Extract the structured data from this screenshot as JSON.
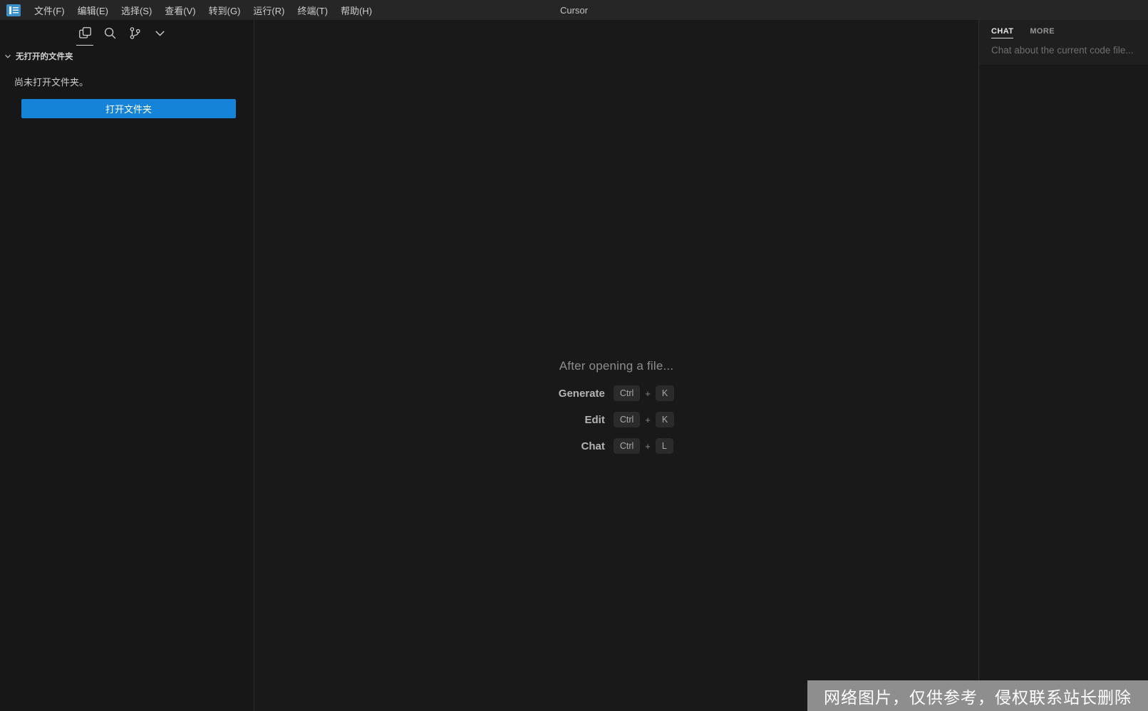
{
  "titlebar": {
    "title": "Cursor",
    "menus": [
      {
        "label": "文件(F)"
      },
      {
        "label": "编辑(E)"
      },
      {
        "label": "选择(S)"
      },
      {
        "label": "查看(V)"
      },
      {
        "label": "转到(G)"
      },
      {
        "label": "运行(R)"
      },
      {
        "label": "终端(T)"
      },
      {
        "label": "帮助(H)"
      }
    ]
  },
  "sidebar": {
    "toolbar_icons": [
      {
        "name": "explorer-icon",
        "active": true
      },
      {
        "name": "search-icon",
        "active": false
      },
      {
        "name": "source-control-icon",
        "active": false
      },
      {
        "name": "chevron-down-icon",
        "active": false
      }
    ],
    "section_header": "无打开的文件夹",
    "empty_message": "尚未打开文件夹。",
    "open_folder_button": "打开文件夹"
  },
  "editor": {
    "heading": "After opening a file...",
    "plus": "+",
    "shortcuts": [
      {
        "label": "Generate",
        "keys": [
          "Ctrl",
          "K"
        ]
      },
      {
        "label": "Edit",
        "keys": [
          "Ctrl",
          "K"
        ]
      },
      {
        "label": "Chat",
        "keys": [
          "Ctrl",
          "L"
        ]
      }
    ]
  },
  "chat_panel": {
    "tabs": [
      {
        "label": "CHAT",
        "active": true
      },
      {
        "label": "MORE",
        "active": false
      }
    ],
    "placeholder": "Chat about the current code file..."
  },
  "watermark": {
    "text": "网络图片，仅供参考，侵权联系站长删除"
  },
  "colors": {
    "accent_blue": "#1583d7",
    "watermark_bg": "#9e9e9e",
    "titlebar_bg": "#262626",
    "sidebar_bg": "#171717",
    "editor_bg": "#191919"
  }
}
